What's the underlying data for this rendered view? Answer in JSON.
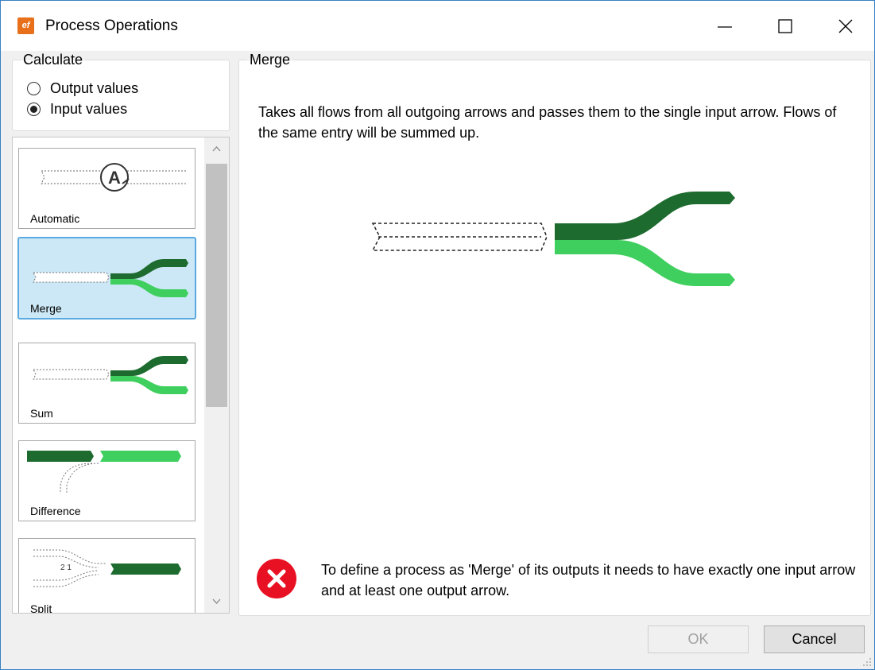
{
  "window": {
    "title": "Process Operations",
    "app_icon_text": "ef",
    "accent": "#3a7fc4"
  },
  "calculate": {
    "legend": "Calculate",
    "options": [
      {
        "label": "Output values",
        "checked": false
      },
      {
        "label": "Input values",
        "checked": true
      }
    ]
  },
  "operations": [
    {
      "label": "Automatic",
      "selected": false
    },
    {
      "label": "Merge",
      "selected": true
    },
    {
      "label": "Sum",
      "selected": false
    },
    {
      "label": "Difference",
      "selected": false
    },
    {
      "label": "Split",
      "selected": false,
      "badge": "2 1"
    }
  ],
  "detail": {
    "legend": "Merge",
    "description": "Takes all flows from all outgoing arrows and passes them to the single input arrow. Flows of the same entry will be summed up.",
    "error": "To define a process as 'Merge' of its outputs it needs to have exactly one input arrow and at least one output arrow.",
    "colors": {
      "dark_green": "#1e6b30",
      "light_green": "#3fcf5e",
      "error_red": "#e81123"
    }
  },
  "buttons": {
    "ok": "OK",
    "cancel": "Cancel"
  }
}
